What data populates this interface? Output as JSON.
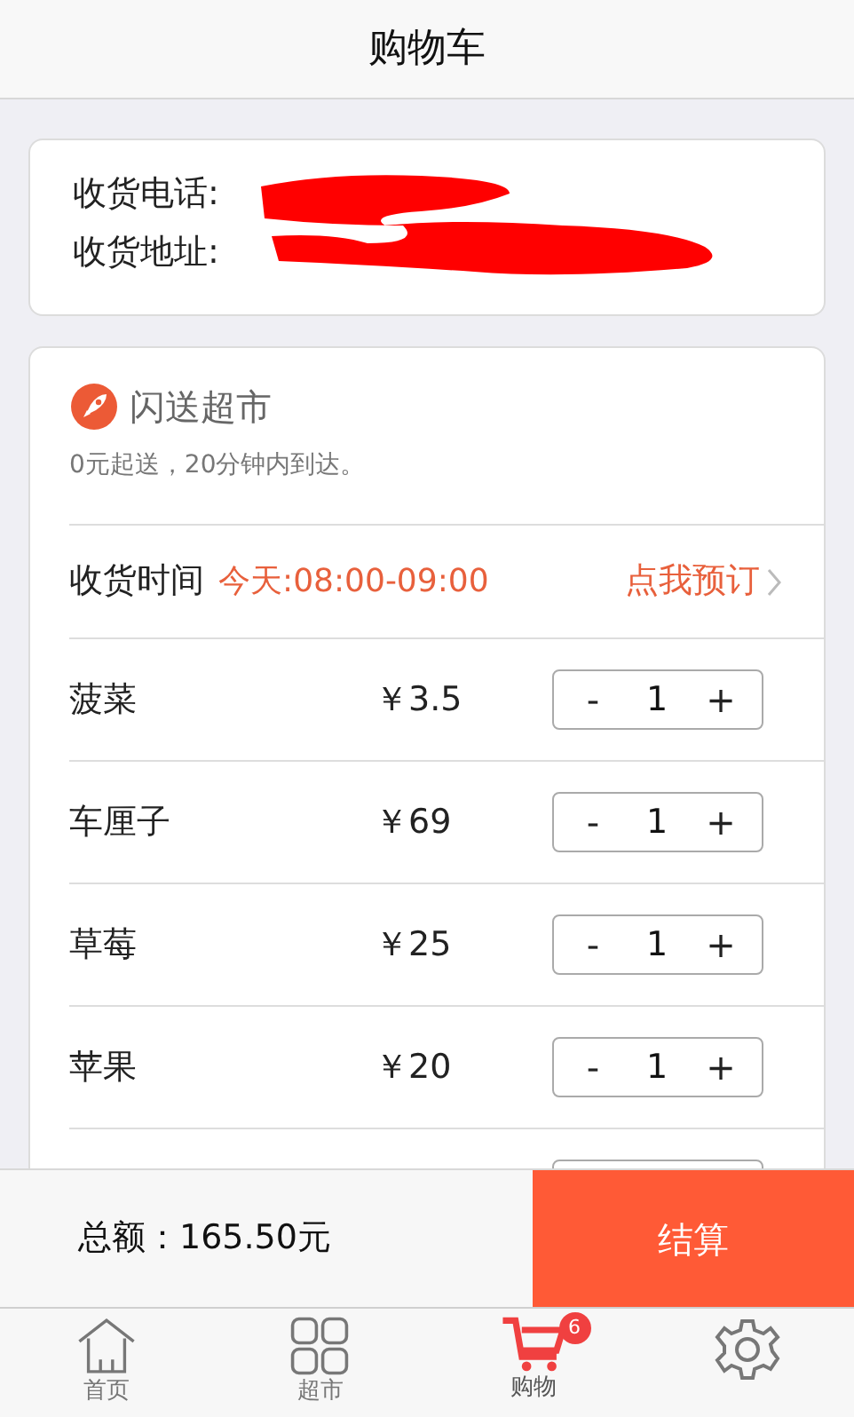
{
  "header": {
    "title": "购物车"
  },
  "address": {
    "phone_label": "收货电话:",
    "address_label": "收货地址:",
    "redacted": true
  },
  "shop": {
    "name": "闪送超市",
    "note": "0元起送，20分钟内到达。",
    "delivery": {
      "label": "收货时间",
      "time": "今天:08:00-09:00",
      "action": "点我预订"
    }
  },
  "items": [
    {
      "name": "菠菜",
      "price": "￥3.5",
      "minus": "-",
      "quantity": "1",
      "plus": "+"
    },
    {
      "name": "车厘子",
      "price": "￥69",
      "minus": "-",
      "quantity": "1",
      "plus": "+"
    },
    {
      "name": "草莓",
      "price": "￥25",
      "minus": "-",
      "quantity": "1",
      "plus": "+"
    },
    {
      "name": "苹果",
      "price": "￥20",
      "minus": "-",
      "quantity": "1",
      "plus": "+"
    }
  ],
  "footer": {
    "total_label": "总额：",
    "total": "165.50元",
    "checkout": "结算"
  },
  "tabs": [
    {
      "kind": "home",
      "label": "首页",
      "selected": false
    },
    {
      "kind": "grid",
      "label": "超市",
      "selected": false
    },
    {
      "kind": "cart",
      "label": "购物",
      "badge": "6",
      "selected": true
    },
    {
      "kind": "gear",
      "selected": false
    }
  ]
}
